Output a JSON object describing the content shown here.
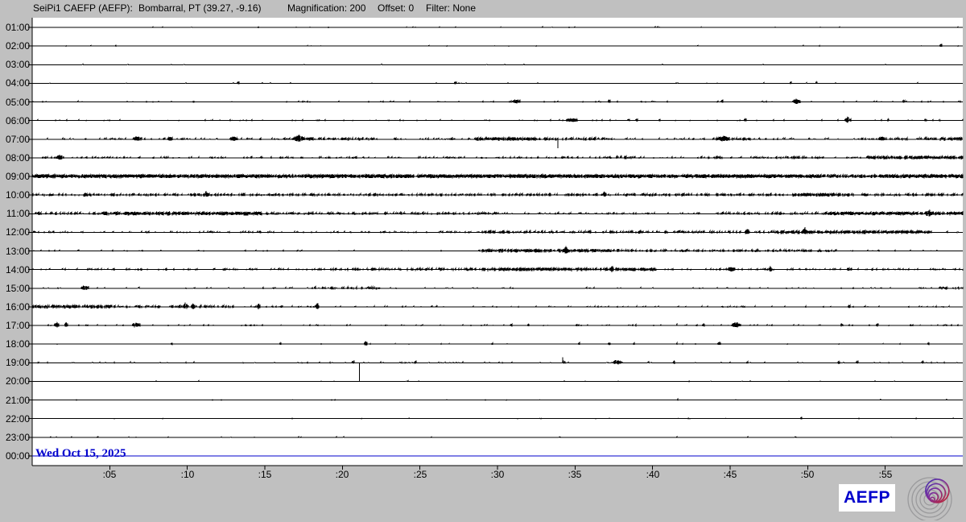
{
  "header": {
    "station": "SeiPi1 CAEFP (AEFP):",
    "location": "Bombarral, PT (39.27, -9.16)",
    "magnification_label": "Magnification: 200",
    "offset_label": "Offset: 0",
    "filter_label": "Filter: None"
  },
  "plot": {
    "date_label": "Wed Oct 15, 2025"
  },
  "branding": {
    "logo_text": "AEFP",
    "logo_icon": "seismo-spiral"
  },
  "colors": {
    "background": "#c0c0c0",
    "plot_bg": "#ffffff",
    "trace": "#000000",
    "accent_blue": "#0000cc",
    "logo_ring_gray": "#9a9a9c",
    "logo_gradient": [
      "#2b2bb8",
      "#7a2e9e",
      "#cc2020"
    ]
  },
  "chart_data": {
    "type": "line",
    "title": "24-hour helicorder seismogram, one 60-minute trace per hour",
    "station": "SeiPi1 CAEFP (AEFP) Bombarral, PT (39.27, -9.16)",
    "magnification": 200,
    "offset": 0,
    "filter": "None",
    "date": "Wed Oct 15, 2025",
    "x_axis": {
      "minutes_range": [
        0,
        60
      ],
      "tick_minutes": [
        5,
        10,
        15,
        20,
        25,
        30,
        35,
        40,
        45,
        50,
        55
      ],
      "tick_labels": [
        ":05",
        ":10",
        ":15",
        ":20",
        ":25",
        ":30",
        ":35",
        ":40",
        ":45",
        ":50",
        ":55"
      ]
    },
    "noise_levels": {
      "flat": [
        0,
        0
      ],
      "L0": [
        0.015,
        0.8
      ],
      "L1": [
        0.08,
        1.0
      ],
      "L2": [
        0.22,
        1.2
      ],
      "L3": [
        0.45,
        1.6
      ],
      "L4": [
        0.8,
        2.0
      ],
      "L5": [
        0.97,
        2.2
      ]
    },
    "rows": [
      {
        "hour": "01:00",
        "segments": [
          [
            0,
            60,
            "L0"
          ]
        ],
        "events": []
      },
      {
        "hour": "02:00",
        "segments": [
          [
            0,
            60,
            "L0"
          ]
        ],
        "events": [
          [
            58.6,
            1,
            1.4
          ]
        ]
      },
      {
        "hour": "03:00",
        "segments": [
          [
            0,
            60,
            "L0"
          ]
        ],
        "events": []
      },
      {
        "hour": "04:00",
        "segments": [
          [
            0,
            60,
            "L0"
          ]
        ],
        "events": [
          [
            13.3,
            1,
            1.4
          ],
          [
            27.3,
            1,
            1.4
          ],
          [
            48.9,
            1,
            1.4
          ],
          [
            50.6,
            1,
            1.4
          ]
        ]
      },
      {
        "hour": "05:00",
        "segments": [
          [
            0,
            60,
            "L1"
          ]
        ],
        "events": [
          [
            31.2,
            3,
            2
          ],
          [
            37.2,
            1,
            1.4
          ],
          [
            44.5,
            1,
            1.4
          ],
          [
            49.3,
            2.5,
            3.5
          ],
          [
            56.2,
            1,
            1.4
          ]
        ]
      },
      {
        "hour": "06:00",
        "segments": [
          [
            0,
            60,
            "L1"
          ]
        ],
        "events": [
          [
            34.8,
            4,
            2.2
          ],
          [
            39,
            1,
            1.4
          ],
          [
            46,
            1,
            1.4
          ],
          [
            52.6,
            2,
            5
          ],
          [
            55.2,
            1,
            1.4
          ],
          [
            57.6,
            1,
            1.4
          ]
        ]
      },
      {
        "hour": "07:00",
        "segments": [
          [
            0,
            16.5,
            "L2"
          ],
          [
            16.5,
            22,
            "L3"
          ],
          [
            22,
            28.5,
            "L2"
          ],
          [
            28.5,
            32.5,
            "L4"
          ],
          [
            32.5,
            37,
            "L3"
          ],
          [
            37,
            44,
            "L2"
          ],
          [
            44,
            46.5,
            "L3"
          ],
          [
            46.5,
            55,
            "L2"
          ],
          [
            55,
            58.5,
            "L3"
          ],
          [
            58.5,
            60,
            "L4"
          ]
        ],
        "events": [
          [
            6.8,
            3,
            3
          ],
          [
            8.9,
            2,
            2
          ],
          [
            13,
            2.5,
            3
          ],
          [
            17.2,
            3.5,
            4.5
          ],
          [
            33.9,
            1,
            0,
            "down",
            11
          ],
          [
            44.6,
            4,
            3
          ],
          [
            54.8,
            2,
            2.5
          ]
        ]
      },
      {
        "hour": "08:00",
        "segments": [
          [
            0,
            37.5,
            "L2"
          ],
          [
            37.5,
            39,
            "L3"
          ],
          [
            39,
            43,
            "L2"
          ],
          [
            43,
            44.5,
            "L3"
          ],
          [
            44.5,
            48,
            "L2"
          ],
          [
            48,
            51,
            "L3"
          ],
          [
            51,
            53.8,
            "L2"
          ],
          [
            53.8,
            60,
            "L4"
          ]
        ],
        "events": [
          [
            1.8,
            2.5,
            3
          ]
        ]
      },
      {
        "hour": "09:00",
        "segments": [
          [
            0,
            51,
            "L5"
          ],
          [
            51,
            55,
            "L4"
          ],
          [
            55,
            60,
            "L5"
          ]
        ],
        "events": []
      },
      {
        "hour": "10:00",
        "segments": [
          [
            0,
            49,
            "L3"
          ],
          [
            49,
            53,
            "L4"
          ],
          [
            53,
            60,
            "L3"
          ]
        ],
        "events": [
          [
            11.2,
            1.2,
            4.5
          ],
          [
            36.9,
            1.2,
            3.5
          ]
        ]
      },
      {
        "hour": "11:00",
        "segments": [
          [
            0,
            4.5,
            "L3"
          ],
          [
            4.5,
            14.8,
            "L4"
          ],
          [
            14.8,
            30,
            "L3"
          ],
          [
            30,
            44,
            "L2"
          ],
          [
            44,
            51,
            "L3"
          ],
          [
            51,
            60,
            "L4"
          ]
        ],
        "events": [
          [
            57.8,
            2,
            3.5
          ]
        ]
      },
      {
        "hour": "12:00",
        "segments": [
          [
            0,
            29,
            "L2"
          ],
          [
            29,
            48,
            "L3"
          ],
          [
            48,
            58,
            "L4"
          ],
          [
            58,
            60,
            "L2"
          ]
        ],
        "events": [
          [
            46.1,
            1.5,
            3.5
          ],
          [
            49.8,
            1.2,
            5.5
          ]
        ]
      },
      {
        "hour": "13:00",
        "segments": [
          [
            0,
            29,
            "L1"
          ],
          [
            29,
            38,
            "L4"
          ],
          [
            38,
            52,
            "L3"
          ],
          [
            52,
            60,
            "L1"
          ]
        ],
        "events": [
          [
            34.4,
            1.2,
            5.5
          ]
        ]
      },
      {
        "hour": "14:00",
        "segments": [
          [
            0,
            18.5,
            "L2"
          ],
          [
            18.5,
            29,
            "L3"
          ],
          [
            29,
            40.2,
            "L4"
          ],
          [
            40.2,
            60,
            "L2"
          ]
        ],
        "events": [
          [
            37.4,
            1,
            4
          ],
          [
            45.1,
            2.5,
            3
          ],
          [
            47.6,
            1,
            4
          ],
          [
            52.7,
            2,
            2
          ]
        ]
      },
      {
        "hour": "15:00",
        "segments": [
          [
            0,
            18,
            "L1"
          ],
          [
            18,
            22.4,
            "L3"
          ],
          [
            22.4,
            58.4,
            "L1"
          ],
          [
            58.4,
            60,
            "L3"
          ]
        ],
        "events": [
          [
            3.4,
            2.5,
            3
          ]
        ]
      },
      {
        "hour": "16:00",
        "segments": [
          [
            0,
            5,
            "L4"
          ],
          [
            5,
            13,
            "L3"
          ],
          [
            13,
            18.7,
            "L2"
          ],
          [
            18.7,
            60,
            "L1"
          ]
        ],
        "events": [
          [
            9.9,
            1.5,
            5.5
          ],
          [
            10.4,
            1,
            4
          ],
          [
            14.6,
            1,
            4
          ],
          [
            18.4,
            1.2,
            4.5
          ],
          [
            52.7,
            1,
            1.4
          ]
        ]
      },
      {
        "hour": "17:00",
        "segments": [
          [
            0,
            60,
            "L1"
          ]
        ],
        "events": [
          [
            1.6,
            1.5,
            4.5
          ],
          [
            2.2,
            1.2,
            3.5
          ],
          [
            6.7,
            2.5,
            3.5
          ],
          [
            30.9,
            1,
            1.4
          ],
          [
            32,
            1,
            1.4
          ],
          [
            38.9,
            1,
            1.4
          ],
          [
            41.6,
            1,
            1.4
          ],
          [
            43.3,
            1,
            1.4
          ],
          [
            45.4,
            3,
            3.5
          ],
          [
            52.2,
            1,
            1.4
          ],
          [
            54.5,
            1,
            1.4
          ]
        ]
      },
      {
        "hour": "18:00",
        "segments": [
          [
            0,
            60,
            "L0"
          ]
        ],
        "events": [
          [
            9,
            1,
            1
          ],
          [
            16,
            1,
            1
          ],
          [
            21.5,
            1.2,
            4.5
          ],
          [
            29.7,
            1,
            1.2
          ],
          [
            35.3,
            1,
            1.2
          ],
          [
            37.2,
            1,
            1.2
          ],
          [
            38.8,
            1,
            1.2
          ],
          [
            41.6,
            1,
            1.2
          ],
          [
            44.3,
            1.2,
            1.8
          ],
          [
            57.8,
            1,
            1.2
          ]
        ]
      },
      {
        "hour": "19:00",
        "segments": [
          [
            0,
            60,
            "L1"
          ]
        ],
        "events": [
          [
            20.7,
            1,
            1.4
          ],
          [
            21.1,
            1,
            0,
            "down",
            23
          ],
          [
            24.7,
            1,
            1.4
          ],
          [
            34.2,
            1,
            0,
            "up",
            7
          ],
          [
            34.3,
            1.2,
            2.5
          ],
          [
            37.7,
            2.5,
            3.5
          ],
          [
            41.4,
            1,
            1.2
          ],
          [
            46.1,
            1,
            1.2
          ],
          [
            52,
            1,
            1.2
          ],
          [
            53.2,
            1,
            1.2
          ],
          [
            57.4,
            1,
            1.2
          ]
        ]
      },
      {
        "hour": "20:00",
        "segments": [
          [
            0,
            60,
            "L0"
          ]
        ],
        "events": []
      },
      {
        "hour": "21:00",
        "segments": [
          [
            0,
            60,
            "L0"
          ]
        ],
        "events": [
          [
            41.6,
            1,
            1.2
          ]
        ]
      },
      {
        "hour": "22:00",
        "segments": [
          [
            0,
            60,
            "L0"
          ]
        ],
        "events": [
          [
            49.6,
            1,
            1.2
          ]
        ]
      },
      {
        "hour": "23:00",
        "segments": [
          [
            0,
            60,
            "L0"
          ]
        ],
        "events": []
      },
      {
        "hour": "00:00",
        "flat": true,
        "color": "#0000cc",
        "segments": [
          [
            0,
            60,
            "flat"
          ]
        ],
        "events": []
      }
    ]
  }
}
